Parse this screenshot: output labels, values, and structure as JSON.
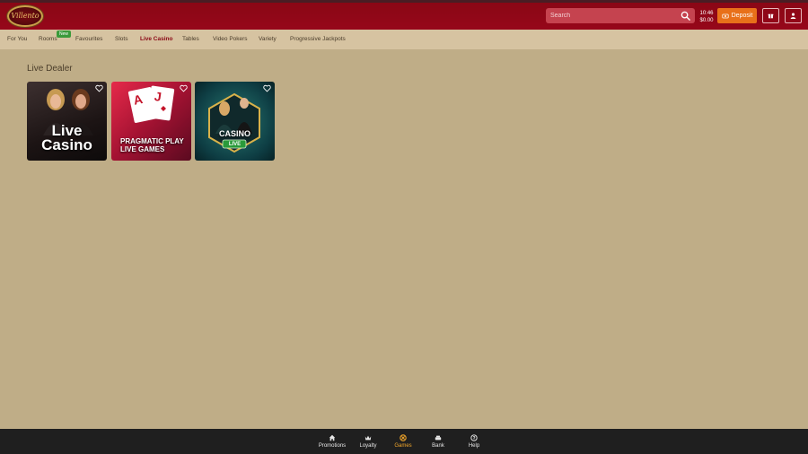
{
  "brand": {
    "logo_text": "Villento"
  },
  "header": {
    "search_placeholder": "Search",
    "clock_time": "10:46",
    "balance": "$0.00",
    "deposit_label": "Deposit"
  },
  "nav": {
    "items": [
      {
        "label": "For You"
      },
      {
        "label": "Rooms"
      },
      {
        "label": "Favourites"
      },
      {
        "label": "Slots"
      },
      {
        "label": "Live Casino"
      },
      {
        "label": "Tables"
      },
      {
        "label": "Video Pokers"
      },
      {
        "label": "Variety"
      },
      {
        "label": "Progressive Jackpots"
      }
    ],
    "active": "Live Casino",
    "new_badge": "New"
  },
  "section": {
    "title": "Live Dealer"
  },
  "tiles": [
    {
      "line1": "Live",
      "line2": "Casino"
    },
    {
      "line1": "PRAGMATIC PLAY",
      "line2": "LIVE GAMES"
    },
    {
      "line1": "CASINO",
      "line2": "LIVE"
    }
  ],
  "footer": {
    "items": [
      {
        "label": "Promotions"
      },
      {
        "label": "Loyalty"
      },
      {
        "label": "Games"
      },
      {
        "label": "Bank"
      },
      {
        "label": "Help"
      }
    ],
    "active": "Games"
  },
  "colors": {
    "header_red": "#96071a",
    "nav_bg": "#d6c3a1",
    "page_bg": "#bfad87",
    "deposit_orange": "#e8701a",
    "active_nav": "#8a0715",
    "footer_bg": "#1f1f1f",
    "footer_active": "#f2a62a",
    "new_badge_green": "#3a9a3a"
  },
  "icons": {
    "search": "search-icon",
    "deposit": "cash-icon",
    "gift": "gift-icon",
    "profile": "user-icon",
    "favourite": "heart-icon",
    "promotions": "home-icon",
    "loyalty": "crown-icon",
    "games": "games-icon",
    "bank": "bank-icon",
    "help": "help-icon"
  }
}
